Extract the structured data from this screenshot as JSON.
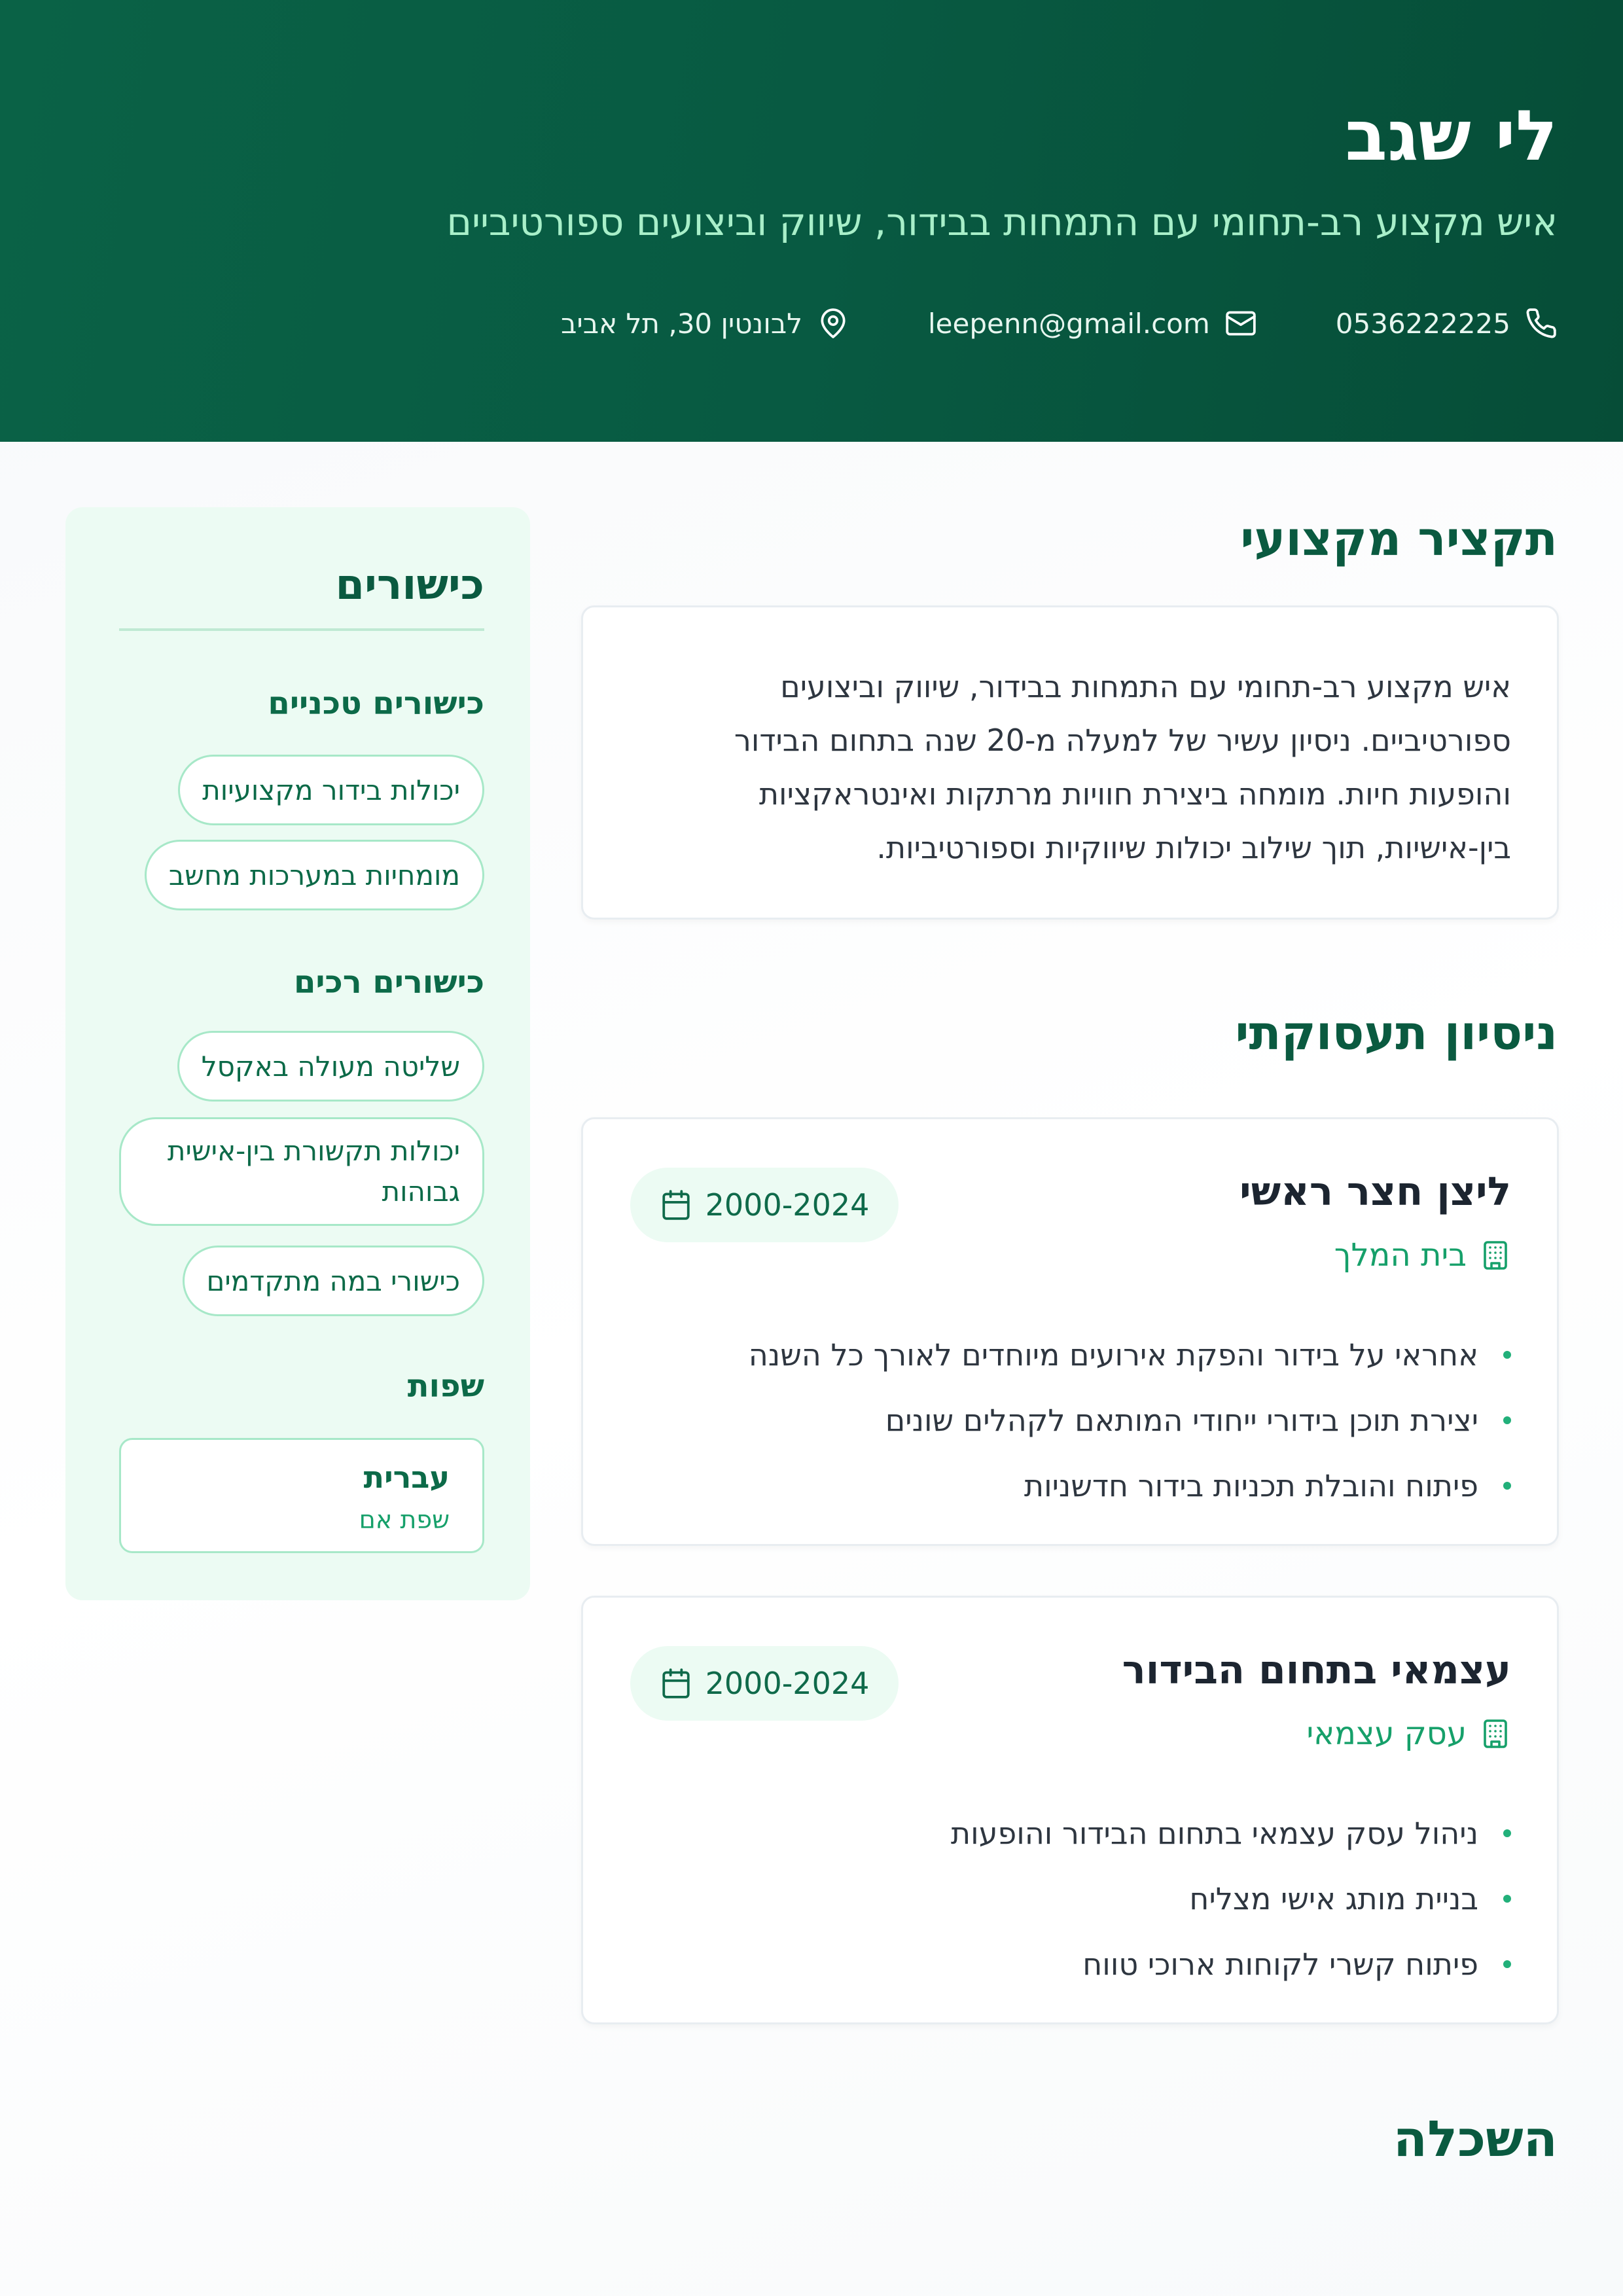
{
  "header": {
    "name": "לי שגב",
    "headline": "איש מקצוע רב-תחומי עם התמחות בבידור, שיווק וביצועים ספורטיביים",
    "phone": "0536222225",
    "email": "leepenn@gmail.com",
    "address": "לבונטין 30, תל אביב",
    "icons": [
      "phone-icon",
      "mail-icon",
      "location-pin-icon"
    ]
  },
  "summary": {
    "title": "תקציר מקצועי",
    "lines": [
      "איש מקצוע רב-תחומי עם התמחות בבידור, שיווק וביצועים",
      "ספורטיביים. ניסיון עשיר של למעלה מ-20 שנה בתחום הבידור",
      "והופעות חיות. מומחה ביצירת חוויות מרתקות ואינטראקציות",
      "בין-אישיות, תוך שילוב יכולות שיווקיות וספורטיביות."
    ]
  },
  "experience": {
    "title": "ניסיון תעסוקתי",
    "jobs": [
      {
        "title": "ליצן חצר ראשי",
        "company": "בית המלך",
        "dates": "2000-2024",
        "bullets": [
          "אחראי על בידור והפקת אירועים מיוחדים לאורך כל השנה",
          "יצירת תוכן בידורי ייחודי המותאם לקהלים שונים",
          "פיתוח והובלת תכניות בידור חדשניות"
        ]
      },
      {
        "title": "עצמאי בתחום הבידור",
        "company": "עסק עצמאי",
        "dates": "2000-2024",
        "bullets": [
          "ניהול עסק עצמאי בתחום הבידור והופעות",
          "בניית מותג אישי מצליח",
          "פיתוח קשרי לקוחות ארוכי טווח"
        ]
      }
    ]
  },
  "education": {
    "title": "השכלה"
  },
  "skills": {
    "title": "כישורים",
    "technical_title": "כישורים טכניים",
    "technical": [
      "יכולות בידור מקצועיות",
      "מומחיות במערכות מחשב"
    ],
    "soft_title": "כישורים רכים",
    "soft": [
      "שליטה מעולה באקסל",
      "יכולות תקשורת בין-אישית גבוהות",
      "כישורי במה מתקדמים"
    ],
    "languages_title": "שפות",
    "languages": [
      {
        "name": "עברית",
        "level": "שפת אם"
      }
    ]
  },
  "colors": {
    "header_bg": "#085a42",
    "accent": "#16a06a",
    "headline": "#a8efc9",
    "sidebar_bg": "#ecfbf3"
  }
}
